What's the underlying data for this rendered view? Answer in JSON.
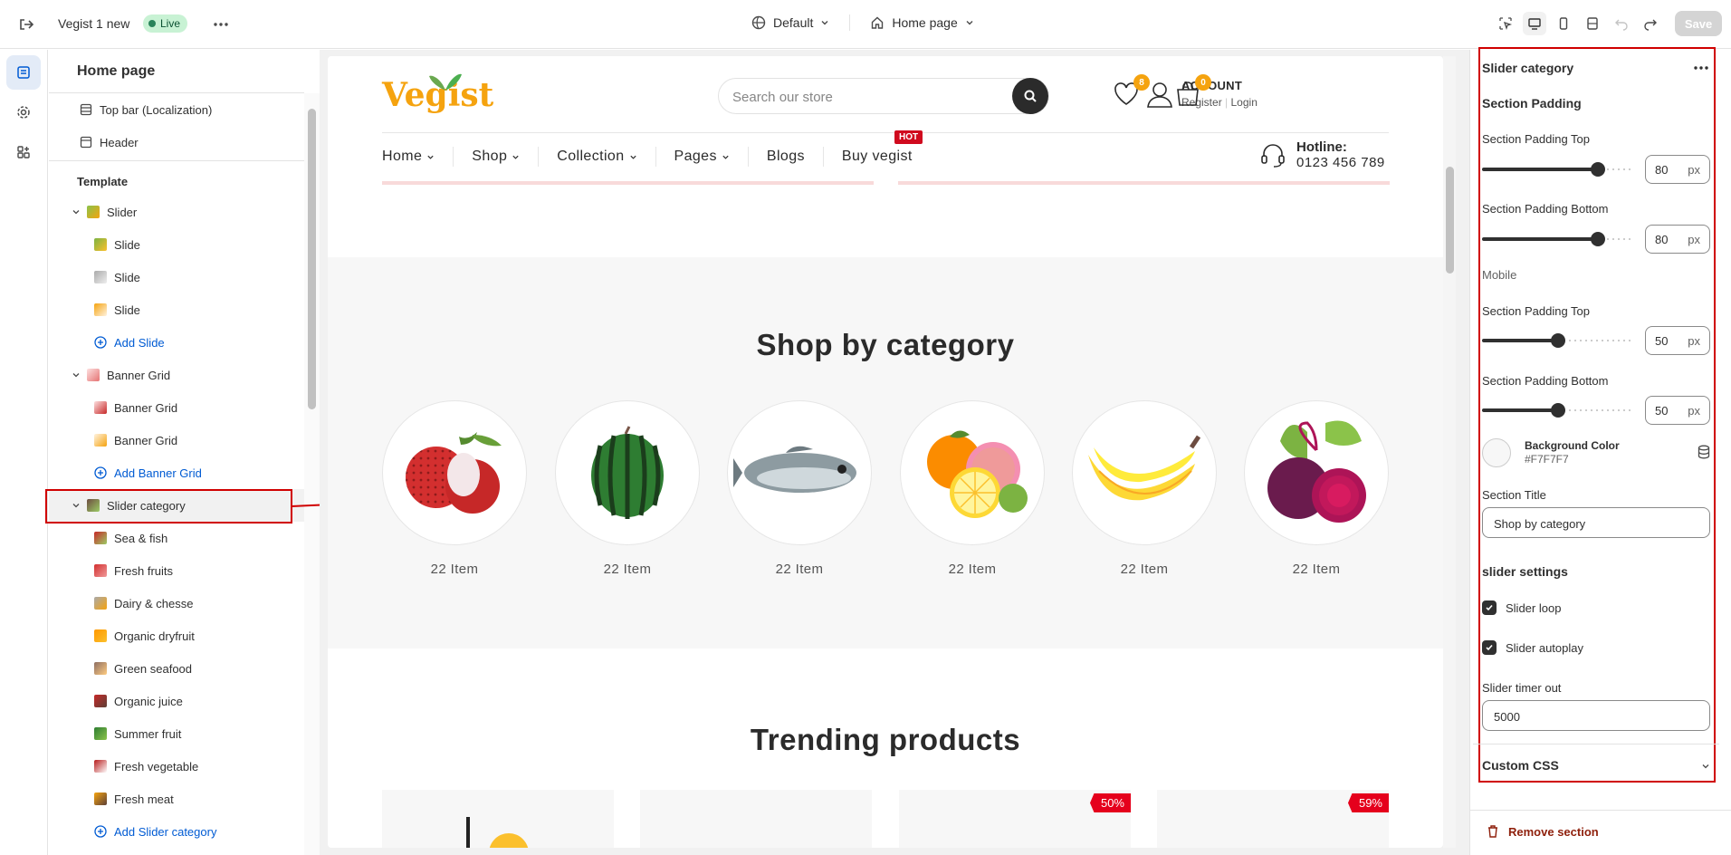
{
  "topbar": {
    "store_title": "Vegist 1 new",
    "live_label": "Live",
    "theme_select": "Default",
    "page_select": "Home page",
    "save_label": "Save"
  },
  "sidebar": {
    "header": "Home page",
    "top_items": [
      {
        "label": "Top bar (Localization)",
        "icon": "topbar-icon"
      },
      {
        "label": "Header",
        "icon": "header-icon"
      }
    ],
    "template_label": "Template",
    "sections": [
      {
        "label": "Slider",
        "children": [
          "Slide",
          "Slide",
          "Slide"
        ],
        "add_label": "Add Slide"
      },
      {
        "label": "Banner Grid",
        "children": [
          "Banner Grid",
          "Banner Grid"
        ],
        "add_label": "Add Banner Grid"
      },
      {
        "label": "Slider category",
        "children": [
          "Sea & fish",
          "Fresh fruits",
          "Dairy & chesse",
          "Organic dryfruit",
          "Green seafood",
          "Organic juice",
          "Summer fruit",
          "Fresh vegetable",
          "Fresh meat"
        ],
        "add_label": "Add Slider category"
      }
    ]
  },
  "preview": {
    "logo": "Vegist",
    "search_placeholder": "Search our store",
    "account_title": "ACCOUNT",
    "register": "Register",
    "login": "Login",
    "wishlist_count": "8",
    "cart_count": "0",
    "nav": [
      "Home",
      "Shop",
      "Collection",
      "Pages",
      "Blogs",
      "Buy vegist"
    ],
    "hot_badge": "HOT",
    "hotline_label": "Hotline:",
    "hotline_number": "0123 456 789",
    "category_title": "Shop by category",
    "categories": [
      {
        "count": "22 Item",
        "image": "lychee"
      },
      {
        "count": "22 Item",
        "image": "watermelon"
      },
      {
        "count": "22 Item",
        "image": "fish"
      },
      {
        "count": "22 Item",
        "image": "citrus"
      },
      {
        "count": "22 Item",
        "image": "banana"
      },
      {
        "count": "22 Item",
        "image": "beetroot"
      }
    ],
    "trending_title": "Trending products",
    "discounts": [
      "50%",
      "59%"
    ]
  },
  "settings": {
    "title": "Slider category",
    "section_padding_heading": "Section Padding",
    "padding_top_label": "Section Padding Top",
    "padding_top_value": "80",
    "padding_bottom_label": "Section Padding Bottom",
    "padding_bottom_value": "80",
    "mobile_label": "Mobile",
    "mobile_top_label": "Section Padding Top",
    "mobile_top_value": "50",
    "mobile_bottom_label": "Section Padding Bottom",
    "mobile_bottom_value": "50",
    "unit": "px",
    "bg_color_label": "Background Color",
    "bg_color_value": "#F7F7F7",
    "section_title_label": "Section Title",
    "section_title_value": "Shop by category",
    "slider_settings_heading": "slider settings",
    "slider_loop_label": "Slider loop",
    "slider_autoplay_label": "Slider autoplay",
    "timer_label": "Slider timer out",
    "timer_value": "5000",
    "custom_css_label": "Custom CSS",
    "remove_label": "Remove section"
  },
  "colors": {
    "accent": "#005bd3",
    "highlight": "#d00000",
    "logo": "#f5a30f",
    "live_bg": "#c8f2d4"
  }
}
